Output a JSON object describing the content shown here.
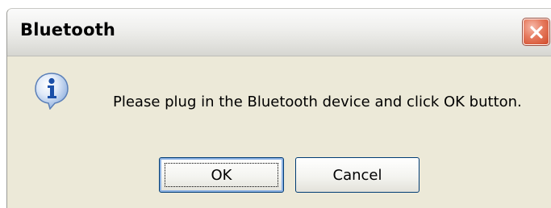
{
  "window": {
    "title": "Bluetooth"
  },
  "dialog": {
    "icon": "info-icon",
    "message": "Please plug in the Bluetooth device and click OK button."
  },
  "buttons": {
    "ok_label": "OK",
    "cancel_label": "Cancel"
  },
  "colors": {
    "close_button": "#d8573a",
    "dialog_background": "#ece9d8",
    "button_border": "#003c74",
    "info_blue": "#1a4fa8"
  }
}
